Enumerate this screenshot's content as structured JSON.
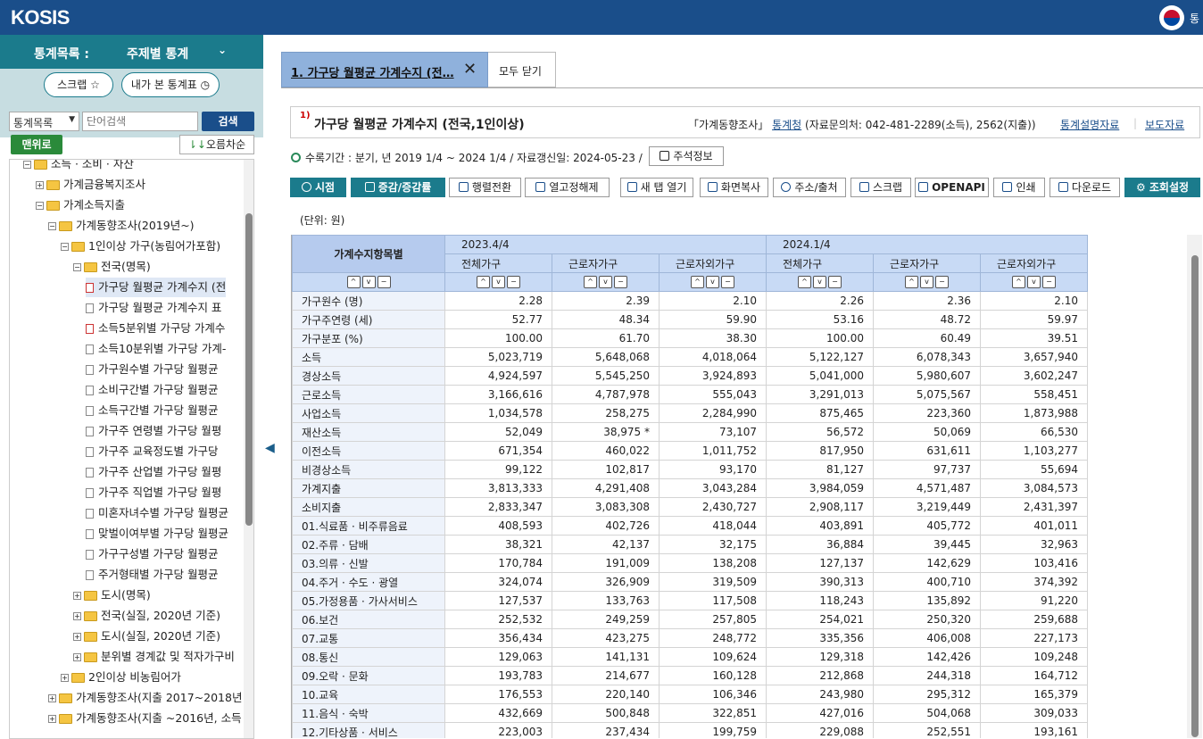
{
  "app": {
    "logo": "KOSIS",
    "top_right": "통"
  },
  "sidebar": {
    "header_label": "통계목록 :",
    "header_value": "주제별 통계",
    "scrap_label": "스크랩 ☆",
    "recent_label": "내가 본 통계표 ◷",
    "search_select": "통계목록",
    "search_placeholder": "단어검색",
    "search_btn": "검색",
    "top_btn": "맨위로",
    "sort_btn": "오름차순",
    "tree": [
      {
        "label": "소득 · 소비 · 자산",
        "type": "folder-open",
        "depth": 1
      },
      {
        "label": "가계금융복지조사",
        "type": "folder-closed",
        "depth": 2
      },
      {
        "label": "가계소득지출",
        "type": "folder-open",
        "depth": 2
      },
      {
        "label": "가계동향조사(2019년~)",
        "type": "folder-open",
        "depth": 3
      },
      {
        "label": "1인이상 가구(농림어가포함)",
        "type": "folder-open",
        "depth": 4
      },
      {
        "label": "전국(명목)",
        "type": "folder-open",
        "depth": 5
      },
      {
        "label": "가구당 월평균 가계수지 (전",
        "type": "doc-red",
        "depth": 6,
        "selected": true
      },
      {
        "label": "가구당 월평균 가계수지 표",
        "type": "doc",
        "depth": 6
      },
      {
        "label": "소득5분위별 가구당 가계수",
        "type": "doc-red",
        "depth": 6
      },
      {
        "label": "소득10분위별 가구당 가계-",
        "type": "doc",
        "depth": 6
      },
      {
        "label": "가구원수별 가구당 월평균",
        "type": "doc",
        "depth": 6
      },
      {
        "label": "소비구간별 가구당 월평균",
        "type": "doc",
        "depth": 6
      },
      {
        "label": "소득구간별 가구당 월평균",
        "type": "doc",
        "depth": 6
      },
      {
        "label": "가구주 연령별 가구당 월평",
        "type": "doc",
        "depth": 6
      },
      {
        "label": "가구주 교육정도별 가구당",
        "type": "doc",
        "depth": 6
      },
      {
        "label": "가구주 산업별 가구당 월평",
        "type": "doc",
        "depth": 6
      },
      {
        "label": "가구주 직업별 가구당 월평",
        "type": "doc",
        "depth": 6
      },
      {
        "label": "미혼자녀수별 가구당 월평균",
        "type": "doc",
        "depth": 6
      },
      {
        "label": "맞벌이여부별 가구당 월평균",
        "type": "doc",
        "depth": 6
      },
      {
        "label": "가구구성별 가구당 월평균",
        "type": "doc",
        "depth": 6
      },
      {
        "label": "주거형태별 가구당 월평균",
        "type": "doc",
        "depth": 6
      },
      {
        "label": "도시(명목)",
        "type": "folder-closed",
        "depth": 5
      },
      {
        "label": "전국(실질, 2020년 기준)",
        "type": "folder-closed",
        "depth": 5
      },
      {
        "label": "도시(실질, 2020년 기준)",
        "type": "folder-closed",
        "depth": 5
      },
      {
        "label": "분위별 경계값 및 적자가구비",
        "type": "folder-closed",
        "depth": 5
      },
      {
        "label": "2인이상 비농림어가",
        "type": "folder-closed",
        "depth": 4
      },
      {
        "label": "가계동향조사(지출 2017~2018년",
        "type": "folder-closed",
        "depth": 3
      },
      {
        "label": "가계동향조사(지출 ~2016년, 소득",
        "type": "folder-closed",
        "depth": 3
      }
    ]
  },
  "tabs": [
    {
      "label": "1. 가구당 월평균 가계수지 (전…"
    },
    {
      "label": "모두 닫기"
    }
  ],
  "title": {
    "sup": "1)",
    "text": "가구당 월평균 가계수지 (전국,1인이상)",
    "survey": "「가계동향조사」",
    "org": "통계청",
    "contact": "(자료문의처: 042-481-2289(소득), 2562(지출))",
    "link1": "통계설명자료",
    "link2": "보도자료"
  },
  "period": "수록기간 : 분기, 년 2019 1/4 ~ 2024 1/4 / 자료갱신일: 2024-05-23 /",
  "note_btn": "주석정보",
  "toolbar": [
    "시점",
    "증감/증감률",
    "행렬전환",
    "열고정해제",
    "새 탭 열기",
    "화면복사",
    "주소/출처",
    "스크랩",
    "OPENAPI",
    "인쇄",
    "다운로드",
    "조회설정"
  ],
  "unit": "(단위: 원)",
  "table": {
    "corner": "가계수지항목별",
    "periods": [
      "2023.4/4",
      "2024.1/4"
    ],
    "cols": [
      "전체가구",
      "근로자가구",
      "근로자외가구",
      "전체가구",
      "근로자가구",
      "근로자외가구"
    ],
    "sort_up": "^",
    "sort_down": "v",
    "sort_minus": "−",
    "rows": [
      {
        "name": "가구원수 (명)",
        "v": [
          "2.28",
          "2.39",
          "2.10",
          "2.26",
          "2.36",
          "2.10"
        ]
      },
      {
        "name": "가구주연령 (세)",
        "v": [
          "52.77",
          "48.34",
          "59.90",
          "53.16",
          "48.72",
          "59.97"
        ]
      },
      {
        "name": "가구분포 (%)",
        "v": [
          "100.00",
          "61.70",
          "38.30",
          "100.00",
          "60.49",
          "39.51"
        ]
      },
      {
        "name": "소득",
        "v": [
          "5,023,719",
          "5,648,068",
          "4,018,064",
          "5,122,127",
          "6,078,343",
          "3,657,940"
        ]
      },
      {
        "name": "경상소득",
        "v": [
          "4,924,597",
          "5,545,250",
          "3,924,893",
          "5,041,000",
          "5,980,607",
          "3,602,247"
        ]
      },
      {
        "name": "근로소득",
        "v": [
          "3,166,616",
          "4,787,978",
          "555,043",
          "3,291,013",
          "5,075,567",
          "558,451"
        ]
      },
      {
        "name": "사업소득",
        "v": [
          "1,034,578",
          "258,275",
          "2,284,990",
          "875,465",
          "223,360",
          "1,873,988"
        ]
      },
      {
        "name": "재산소득",
        "v": [
          "52,049",
          "38,975 *",
          "73,107",
          "56,572",
          "50,069",
          "66,530"
        ]
      },
      {
        "name": "이전소득",
        "v": [
          "671,354",
          "460,022",
          "1,011,752",
          "817,950",
          "631,611",
          "1,103,277"
        ]
      },
      {
        "name": "비경상소득",
        "v": [
          "99,122",
          "102,817",
          "93,170",
          "81,127",
          "97,737",
          "55,694"
        ]
      },
      {
        "name": "가계지출",
        "v": [
          "3,813,333",
          "4,291,408",
          "3,043,284",
          "3,984,059",
          "4,571,487",
          "3,084,573"
        ]
      },
      {
        "name": "소비지출",
        "v": [
          "2,833,347",
          "3,083,308",
          "2,430,727",
          "2,908,117",
          "3,219,449",
          "2,431,397"
        ]
      },
      {
        "name": "01.식료품 · 비주류음료",
        "v": [
          "408,593",
          "402,726",
          "418,044",
          "403,891",
          "405,772",
          "401,011"
        ]
      },
      {
        "name": "02.주류 · 담배",
        "v": [
          "38,321",
          "42,137",
          "32,175",
          "36,884",
          "39,445",
          "32,963"
        ]
      },
      {
        "name": "03.의류 · 신발",
        "v": [
          "170,784",
          "191,009",
          "138,208",
          "127,137",
          "142,629",
          "103,416"
        ]
      },
      {
        "name": "04.주거 · 수도 · 광열",
        "v": [
          "324,074",
          "326,909",
          "319,509",
          "390,313",
          "400,710",
          "374,392"
        ]
      },
      {
        "name": "05.가정용품 · 가사서비스",
        "v": [
          "127,537",
          "133,763",
          "117,508",
          "118,243",
          "135,892",
          "91,220"
        ]
      },
      {
        "name": "06.보건",
        "v": [
          "252,532",
          "249,259",
          "257,805",
          "254,021",
          "250,320",
          "259,688"
        ]
      },
      {
        "name": "07.교통",
        "v": [
          "356,434",
          "423,275",
          "248,772",
          "335,356",
          "406,008",
          "227,173"
        ]
      },
      {
        "name": "08.통신",
        "v": [
          "129,063",
          "141,131",
          "109,624",
          "129,318",
          "142,426",
          "109,248"
        ]
      },
      {
        "name": "09.오락 · 문화",
        "v": [
          "193,783",
          "214,677",
          "160,128",
          "212,868",
          "244,318",
          "164,712"
        ]
      },
      {
        "name": "10.교육",
        "v": [
          "176,553",
          "220,140",
          "106,346",
          "243,980",
          "295,312",
          "165,379"
        ]
      },
      {
        "name": "11.음식 · 숙박",
        "v": [
          "432,669",
          "500,848",
          "322,851",
          "427,016",
          "504,068",
          "309,033"
        ]
      },
      {
        "name": "12.기타상품 · 서비스",
        "v": [
          "223,003",
          "237,434",
          "199,759",
          "229,088",
          "252,551",
          "193,161"
        ]
      }
    ]
  }
}
